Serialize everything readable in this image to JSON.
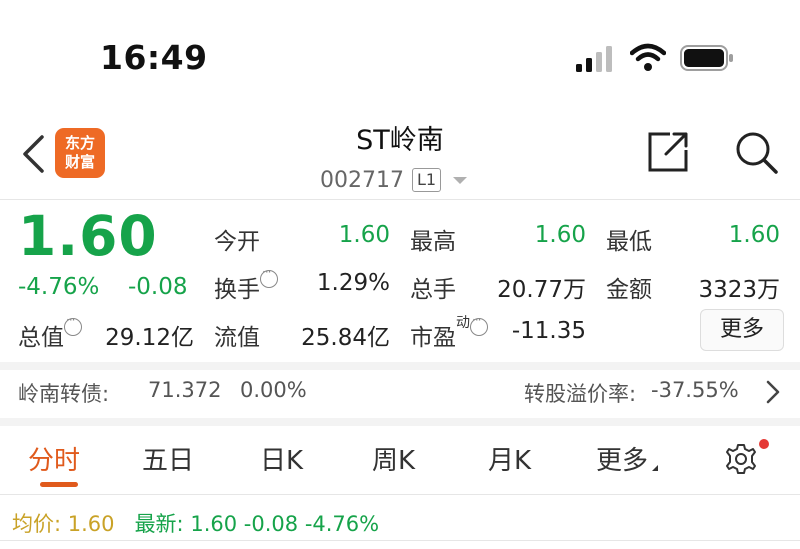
{
  "status_bar": {
    "time": "16:49"
  },
  "nav": {
    "logo_line1": "东方",
    "logo_line2": "财富",
    "stock_name": "ST岭南",
    "stock_code": "002717",
    "level": "L1"
  },
  "quote": {
    "price": "1.60",
    "change_pct": "-4.76%",
    "change_amt": "-0.08",
    "open_label": "今开",
    "open_value": "1.60",
    "high_label": "最高",
    "high_value": "1.60",
    "low_label": "最低",
    "low_value": "1.60",
    "turnover_label": "换手",
    "turnover_value": "1.29%",
    "volume_label": "总手",
    "volume_value": "20.77万",
    "amount_label": "金额",
    "amount_value": "3323万",
    "mcap_label": "总值",
    "mcap_value": "29.12亿",
    "float_label": "流值",
    "float_value": "25.84亿",
    "pe_label": "市盈",
    "pe_sup": "动",
    "pe_value": "-11.35",
    "more_label": "更多"
  },
  "bond": {
    "name": "岭南转债:",
    "price": "71.372",
    "change": "0.00%",
    "premium_label": "转股溢价率:",
    "premium_value": "-37.55%"
  },
  "tabs": [
    {
      "label": "分时",
      "active": true
    },
    {
      "label": "五日",
      "active": false
    },
    {
      "label": "日K",
      "active": false
    },
    {
      "label": "周K",
      "active": false
    },
    {
      "label": "月K",
      "active": false
    },
    {
      "label": "更多",
      "active": false
    }
  ],
  "intraday": {
    "avg_label": "均价:",
    "avg_value": "1.60",
    "latest_label": "最新:",
    "latest_value": "1.60",
    "latest_change": "-0.08",
    "latest_pct": "-4.76%"
  },
  "colors": {
    "down": "#16a34a",
    "accent": "#e05a1c",
    "avg": "#c9a227",
    "logo": "#ee6a25"
  }
}
